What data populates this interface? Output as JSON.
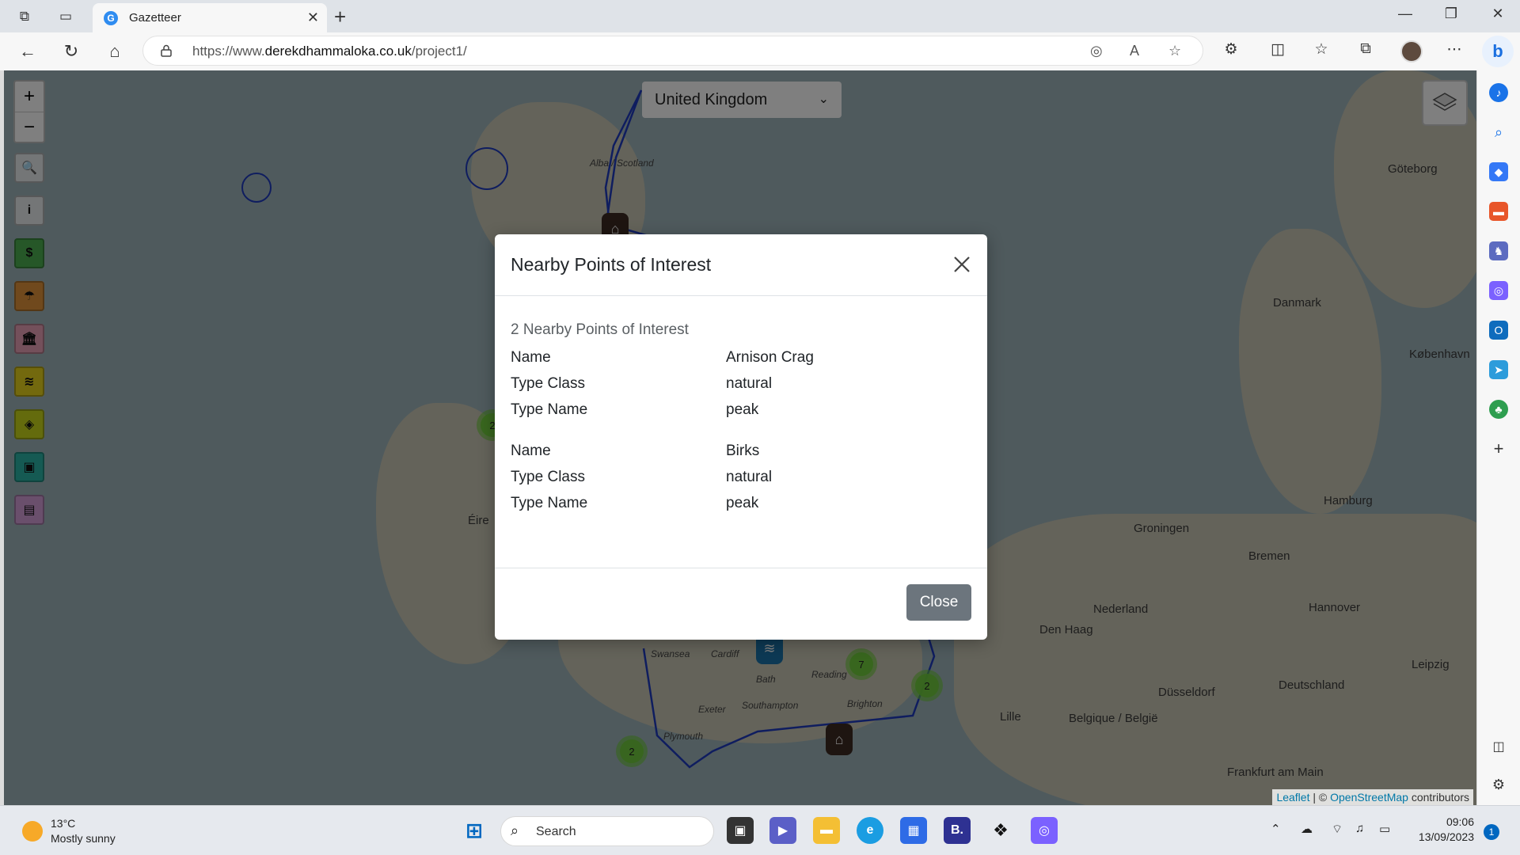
{
  "browser": {
    "tab_title": "Gazetteer",
    "tab_favicon": "G",
    "url_prefix": "https://www.",
    "url_host": "derekdhammaloka.co.uk",
    "url_path": "/project1/"
  },
  "map": {
    "country_selected": "United Kingdom",
    "zoom_in": "+",
    "zoom_out": "−",
    "controls": [
      {
        "name": "search-icon",
        "glyph": "🔍",
        "color": "#e9ecef"
      },
      {
        "name": "info-icon",
        "glyph": "i",
        "color": "#e9ecef"
      },
      {
        "name": "currency-icon",
        "glyph": "$",
        "color": "#4caf50"
      },
      {
        "name": "weather-icon",
        "glyph": "☂",
        "color": "#e0933a"
      },
      {
        "name": "bank-icon",
        "glyph": "🏛",
        "color": "#e9a0b6"
      },
      {
        "name": "database-icon",
        "glyph": "≋",
        "color": "#e7d21c"
      },
      {
        "name": "location-icon",
        "glyph": "◈",
        "color": "#c8d61b"
      },
      {
        "name": "contact-card-icon",
        "glyph": "▣",
        "color": "#2bb4a6"
      },
      {
        "name": "news-icon",
        "glyph": "▤",
        "color": "#d59ed8"
      }
    ],
    "labels": [
      {
        "text": "Alba / Scotland",
        "small": true
      },
      {
        "text": "Éire",
        "small": false
      },
      {
        "text": "Danmark",
        "small": false
      },
      {
        "text": "Göteborg",
        "small": false
      },
      {
        "text": "København",
        "small": false
      },
      {
        "text": "Hamburg",
        "small": false
      },
      {
        "text": "Groningen",
        "small": false
      },
      {
        "text": "Bremen",
        "small": false
      },
      {
        "text": "Nederland",
        "small": false
      },
      {
        "text": "Hannover",
        "small": false
      },
      {
        "text": "Den Haag",
        "small": false
      },
      {
        "text": "Düsseldorf",
        "small": false
      },
      {
        "text": "Deutschland",
        "small": false
      },
      {
        "text": "Belgique / België",
        "small": false
      },
      {
        "text": "Leipzig",
        "small": false
      },
      {
        "text": "Frankfurt am Main",
        "small": false
      },
      {
        "text": "Lille",
        "small": false
      },
      {
        "text": "Brighton",
        "small": false
      },
      {
        "text": "Plymouth",
        "small": false
      },
      {
        "text": "Bath",
        "small": false
      },
      {
        "text": "Reading",
        "small": false
      },
      {
        "text": "Southampton",
        "small": false
      },
      {
        "text": "Exeter",
        "small": false
      },
      {
        "text": "Swansea",
        "small": false
      },
      {
        "text": "Cardiff",
        "small": false
      }
    ],
    "clusters": [
      "2",
      "7",
      "2",
      "2"
    ],
    "attribution_leaflet": "Leaflet",
    "attribution_osm": "OpenStreetMap",
    "attribution_suffix": "contributors"
  },
  "modal": {
    "title": "Nearby Points of Interest",
    "count_text": "2 Nearby Points of Interest",
    "poi": [
      {
        "name_label": "Name",
        "name": "Arnison Crag",
        "class_label": "Type Class",
        "type_class": "natural",
        "tname_label": "Type Name",
        "type_name": "peak"
      },
      {
        "name_label": "Name",
        "name": "Birks",
        "class_label": "Type Class",
        "type_class": "natural",
        "tname_label": "Type Name",
        "type_name": "peak"
      }
    ],
    "close_label": "Close"
  },
  "taskbar": {
    "weather_temp": "13°C",
    "weather_desc": "Mostly sunny",
    "search_label": "Search",
    "time": "09:06",
    "date": "13/09/2023",
    "notifications": "1"
  }
}
